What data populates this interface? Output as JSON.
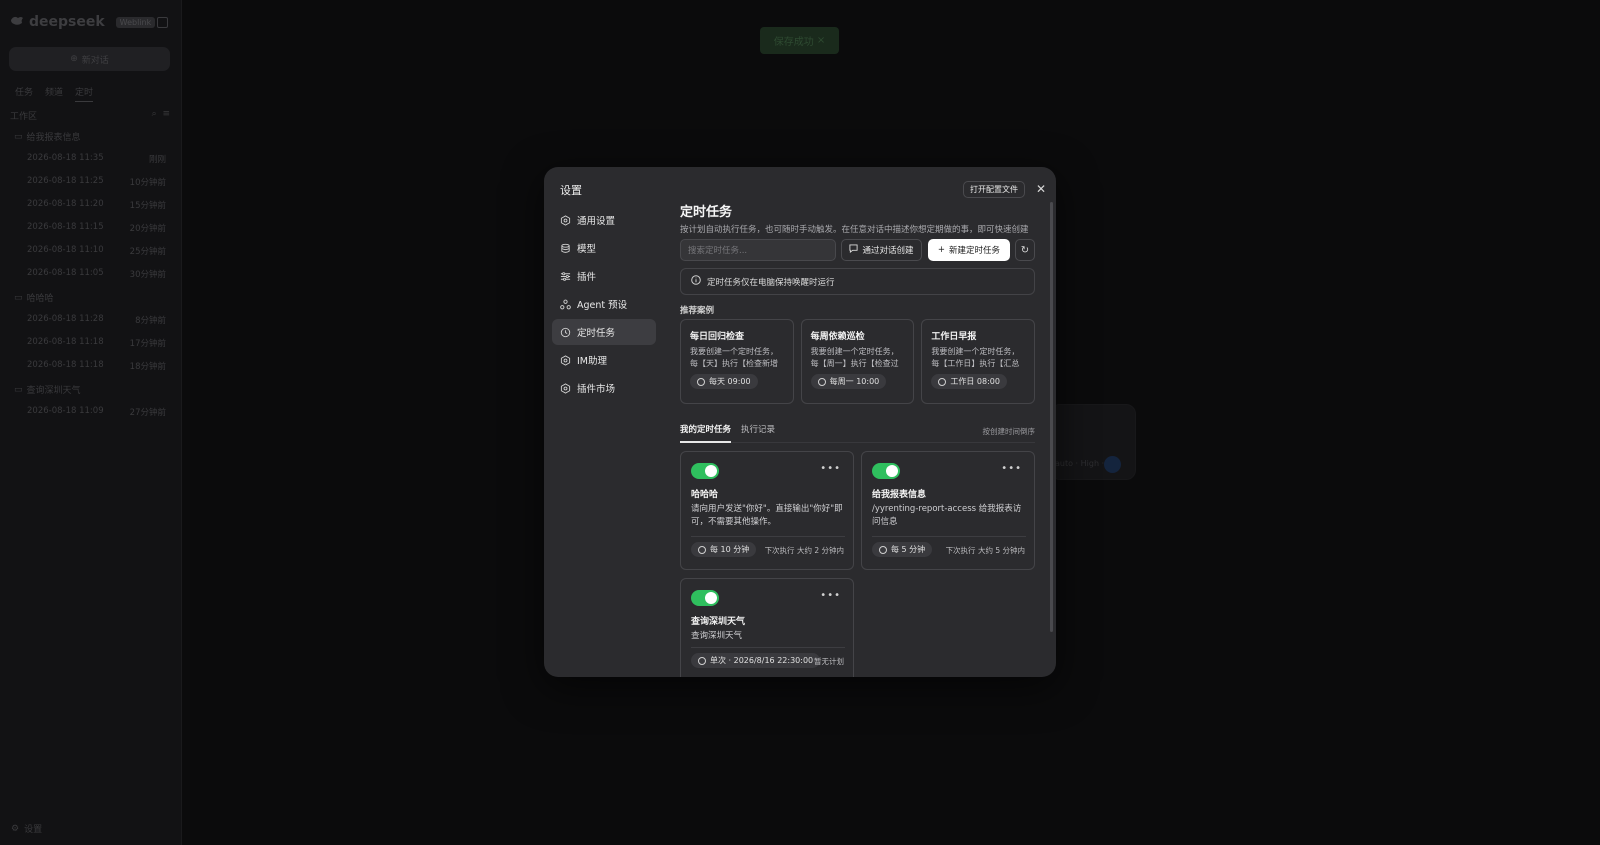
{
  "background": {
    "brand": "deepseek",
    "brand_badge": "Weblink",
    "new_chat_label": "新对话",
    "tabs": [
      "任务",
      "频道",
      "定时"
    ],
    "workspace_label": "工作区",
    "groups": [
      {
        "name": "给我报表信息",
        "items": [
          {
            "time": "2026-08-18 11:35",
            "ago": "刚刚"
          },
          {
            "time": "2026-08-18 11:25",
            "ago": "10分钟前"
          },
          {
            "time": "2026-08-18 11:20",
            "ago": "15分钟前"
          },
          {
            "time": "2026-08-18 11:15",
            "ago": "20分钟前"
          },
          {
            "time": "2026-08-18 11:10",
            "ago": "25分钟前"
          },
          {
            "time": "2026-08-18 11:05",
            "ago": "30分钟前"
          }
        ]
      },
      {
        "name": "哈哈哈",
        "items": [
          {
            "time": "2026-08-18 11:28",
            "ago": "8分钟前"
          },
          {
            "time": "2026-08-18 11:18",
            "ago": "17分钟前"
          },
          {
            "time": "2026-08-18 11:18",
            "ago": "18分钟前"
          }
        ]
      },
      {
        "name": "查询深圳天气",
        "items": [
          {
            "time": "2026-08-18 11:09",
            "ago": "27分钟前"
          }
        ]
      }
    ],
    "settings_label": "设置",
    "toast": "保存成功",
    "input_hint": "auto · High ·"
  },
  "modal": {
    "title": "设置",
    "open_config_label": "打开配置文件",
    "nav": [
      {
        "label": "通用设置",
        "icon": "hexagon-gear-icon"
      },
      {
        "label": "模型",
        "icon": "database-icon"
      },
      {
        "label": "插件",
        "icon": "sliders-icon"
      },
      {
        "label": "Agent 预设",
        "icon": "agent-icon"
      },
      {
        "label": "定时任务",
        "icon": "clock-icon"
      },
      {
        "label": "IM助理",
        "icon": "hexagon-gear-icon"
      },
      {
        "label": "插件市场",
        "icon": "hexagon-gear-icon"
      }
    ],
    "active_nav": "定时任务",
    "heading": "定时任务",
    "description": "按计划自动执行任务，也可随时手动触发。在任意对话中描述你想定期做的事，即可快速创建",
    "search_placeholder": "搜索定时任务...",
    "create_via_chat_label": "通过对话创建",
    "new_task_label": "新建定时任务",
    "notice": "定时任务仅在电脑保持唤醒时运行",
    "recommended_label": "推荐案例",
    "recommended": [
      {
        "title": "每日回归检查",
        "desc": "我要创建一个定时任务，每【天】执行【检查新增测...",
        "schedule": "每天 09:00"
      },
      {
        "title": "每周依赖巡检",
        "desc": "我要创建一个定时任务，每【周一】执行【检查过期...",
        "schedule": "每周一 10:00"
      },
      {
        "title": "工作日早报",
        "desc": "我要创建一个定时任务，每【工作日】执行【汇总昨...",
        "schedule": "工作日 08:00"
      }
    ],
    "tabs": [
      "我的定时任务",
      "执行记录"
    ],
    "sort_label": "按创建时间倒序",
    "tasks": [
      {
        "name": "哈哈哈",
        "desc": "请向用户发送\"你好\"。直接输出\"你好\"即可，不需要其他操作。",
        "schedule": "每 10 分钟",
        "next": "下次执行 大约 2 分钟内",
        "enabled": true
      },
      {
        "name": "给我报表信息",
        "desc": "/yyrenting-report-access 给我报表访问信息",
        "schedule": "每 5 分钟",
        "next": "下次执行 大约 5 分钟内",
        "enabled": true
      },
      {
        "name": "查询深圳天气",
        "desc": "查询深圳天气",
        "schedule": "单次 · 2026/8/16 22:30:00",
        "next": "暂无计划",
        "enabled": true
      }
    ]
  },
  "colors": {
    "toggle_on": "#2fbf5e",
    "modal_bg": "#2b2b2e",
    "overlay": "#0b0b0c"
  }
}
